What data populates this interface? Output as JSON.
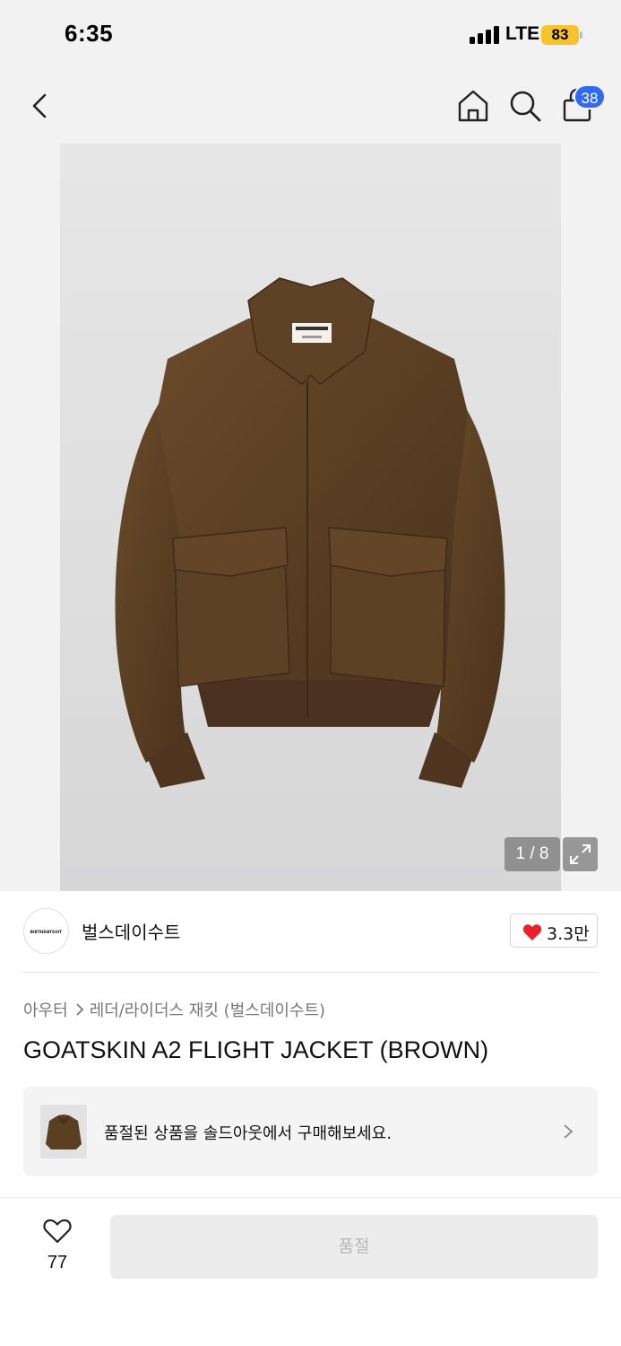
{
  "status_bar": {
    "time": "6:35",
    "network": "LTE",
    "battery": "83"
  },
  "nav": {
    "icons": [
      "back-icon",
      "home-icon",
      "search-icon",
      "shopping-bag-icon"
    ],
    "cart_badge": "38"
  },
  "gallery": {
    "counter": "1 / 8",
    "expand_icon": "expand-icon",
    "product_color": "#5a3f23"
  },
  "brand": {
    "logo_text": "BIRTHDAYSUIT",
    "name": "벌스데이수트",
    "like_count": "3.3만",
    "like_color": "#e8232a"
  },
  "category": {
    "primary": "아우터",
    "secondary": "레더/라이더스 재킷 (벌스데이수트)"
  },
  "product": {
    "title": "GOATSKIN A2 FLIGHT JACKET (BROWN)"
  },
  "soldout_banner": {
    "text": "품절된 상품을 솔드아웃에서 구매해보세요."
  },
  "bottom_bar": {
    "wish_count": "77",
    "soldout_label": "품절"
  }
}
